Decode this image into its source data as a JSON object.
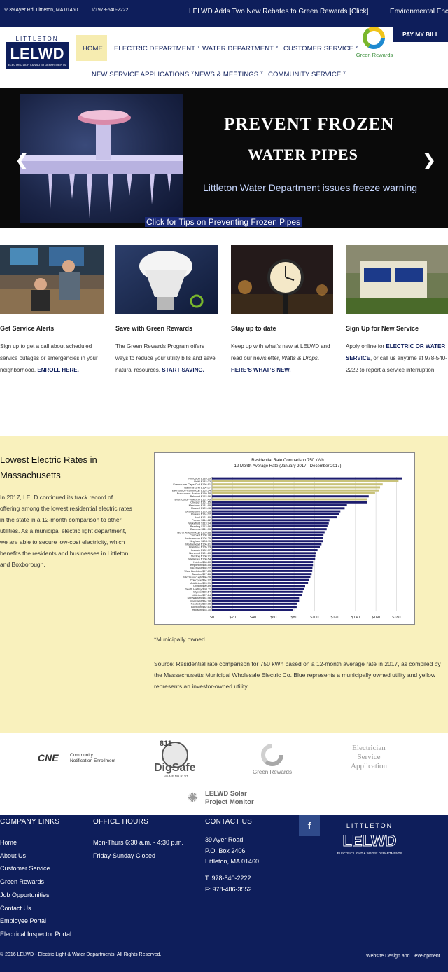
{
  "topbar": {
    "address": "39 Ayer Rd, Littleton, MA 01460",
    "phone": "978-540-2222",
    "ticker": "LELWD Adds Two New Rebates to Green Rewards [Click]",
    "ticker2": "Environmental Enc"
  },
  "header": {
    "logo_top": "LITTLETON",
    "logo_main": "LELWD",
    "logo_sub": "ELECTRIC LIGHT & WATER DEPARTMENTS",
    "pay_bill": "PAY MY BILL",
    "green_rewards": "Green Rewards",
    "nav": [
      "HOME",
      "ELECTRIC DEPARTMENT",
      "WATER DEPARTMENT",
      "CUSTOMER SERVICE",
      "NEW SERVICE APPLICATIONS",
      "NEWS & MEETINGS",
      "COMMUNITY SERVICE"
    ]
  },
  "hero": {
    "title1": "PREVENT FROZEN",
    "title2": "WATER PIPES",
    "subtitle": "Littleton Water Department issues freeze warning",
    "link": "Click for Tips on Preventing Frozen Pipes"
  },
  "cards": [
    {
      "title": "Get Service Alerts",
      "text": "Sign up to get a call about scheduled service outages or emergencies in your neighborhood. ",
      "link": "ENROLL HERE."
    },
    {
      "title": "Save with Green Rewards",
      "text": "The Green Rewards Program offers ways to reduce your utility bills and save natural resources. ",
      "link": "START SAVING."
    },
    {
      "title": "Stay up to date",
      "text_a": "Keep up with what’s new at LELWD and read our newsletter, ",
      "italic": "Watts & Drops",
      "text_b": ". ",
      "link": "HERE’S WHAT’S NEW."
    },
    {
      "title": "Sign Up for New Service",
      "text_a": "Apply online for ",
      "link": "ELECTRIC OR WATER SERVICE",
      "text_b": ", or call us anytime at 978-540-2222 to report a service interruption."
    }
  ],
  "rates": {
    "heading": "Lowest Electric Rates in Massachusetts",
    "body": "In 2017, LELD continued its track record of offering among the lowest residential electric rates in the state in a 12-month comparison to other utilities. As a municipal electric light department, we are able to secure low-cost electricity, which benefits the residents and businesses in Littleton and Boxborough.",
    "note": "*Municipally owned",
    "source": "Source: Residential rate comparison for 750 kWh based on a 12-month average rate in 2017, as compiled by the Massachusetts Municipal Wholesale Electric Co. Blue represents a municipally owned utility and yellow represents an investor-owned utility."
  },
  "chart_data": {
    "type": "bar",
    "orientation": "horizontal",
    "title": "Residential Rate Comparison 750 kWh",
    "subtitle": "12 Month Average Rate (January 2017 - December 2017)",
    "xlim": [
      0,
      190
    ],
    "xticks": [
      "$0",
      "$20",
      "$40",
      "$60",
      "$80",
      "$100",
      "$120",
      "$140",
      "$160",
      "$180"
    ],
    "grid": true,
    "colors": {
      "municipal": "#1c1c6e",
      "investor": "#c8c27a"
    },
    "bars": [
      {
        "label": "Princeton",
        "value": 185.29,
        "type": "municipal"
      },
      {
        "label": "Unitil",
        "value": 182.03,
        "type": "investor"
      },
      {
        "label": "Eversource-Cape Cod",
        "value": 166.61,
        "type": "investor"
      },
      {
        "label": "National Grid",
        "value": 164.07,
        "type": "investor"
      },
      {
        "label": "Eversource-Cambridge",
        "value": 163.34,
        "type": "investor"
      },
      {
        "label": "Eversource-Boston",
        "value": 159.18,
        "type": "investor"
      },
      {
        "label": "Belmont",
        "value": 152.96,
        "type": "municipal"
      },
      {
        "label": "Eversource-WMECO",
        "value": 151.49,
        "type": "investor"
      },
      {
        "label": "Chester",
        "value": 151.15,
        "type": "municipal"
      },
      {
        "label": "Merrimac",
        "value": 131.68,
        "type": "municipal"
      },
      {
        "label": "Russell",
        "value": 129.46,
        "type": "municipal"
      },
      {
        "label": "Georgetown",
        "value": 125.26,
        "type": "municipal"
      },
      {
        "label": "Rowley",
        "value": 124.02,
        "type": "municipal"
      },
      {
        "label": "Hull",
        "value": 121.8,
        "type": "municipal"
      },
      {
        "label": "Paxton",
        "value": 114.62,
        "type": "municipal"
      },
      {
        "label": "Wakefield",
        "value": 113.94,
        "type": "municipal"
      },
      {
        "label": "Reading",
        "value": 112.66,
        "type": "municipal"
      },
      {
        "label": "Danvers",
        "value": 111.9,
        "type": "municipal"
      },
      {
        "label": "North Attleborough",
        "value": 109.88,
        "type": "municipal"
      },
      {
        "label": "Concord",
        "value": 108.78,
        "type": "municipal"
      },
      {
        "label": "Ashburnham",
        "value": 108.25,
        "type": "municipal"
      },
      {
        "label": "Hingham",
        "value": 108.11,
        "type": "municipal"
      },
      {
        "label": "Marblehead",
        "value": 106.81,
        "type": "municipal"
      },
      {
        "label": "Braintree",
        "value": 105.23,
        "type": "municipal"
      },
      {
        "label": "Ipswich",
        "value": 102.97,
        "type": "municipal"
      },
      {
        "label": "Norwood",
        "value": 101.6,
        "type": "municipal"
      },
      {
        "label": "Sterling",
        "value": 100.91,
        "type": "municipal"
      },
      {
        "label": "Wellesley",
        "value": 100.64,
        "type": "municipal"
      },
      {
        "label": "Holden",
        "value": 98.6,
        "type": "municipal"
      },
      {
        "label": "Templeton",
        "value": 98.55,
        "type": "municipal"
      },
      {
        "label": "Westfield",
        "value": 98.02,
        "type": "municipal"
      },
      {
        "label": "West Boylston",
        "value": 97.85,
        "type": "municipal"
      },
      {
        "label": "Taunton",
        "value": 97.26,
        "type": "municipal"
      },
      {
        "label": "Middleborough",
        "value": 96.0,
        "type": "municipal"
      },
      {
        "label": "Chicopee",
        "value": 94.92,
        "type": "municipal"
      },
      {
        "label": "Middleton",
        "value": 93.71,
        "type": "municipal"
      },
      {
        "label": "Groton",
        "value": 90.89,
        "type": "municipal"
      },
      {
        "label": "South Hadley",
        "value": 90.11,
        "type": "municipal"
      },
      {
        "label": "Holyoke",
        "value": 88.64,
        "type": "municipal"
      },
      {
        "label": "Littleton",
        "value": 87.64,
        "type": "municipal"
      },
      {
        "label": "Shrewsbury",
        "value": 84.96,
        "type": "municipal"
      },
      {
        "label": "Mansfield",
        "value": 84.98,
        "type": "municipal"
      },
      {
        "label": "Peabody",
        "value": 83.06,
        "type": "municipal"
      },
      {
        "label": "Boylston",
        "value": 82.63,
        "type": "municipal"
      },
      {
        "label": "Hudson",
        "value": 78.7,
        "type": "municipal"
      }
    ]
  },
  "partners": {
    "cne_main": "CNE",
    "cne_sub1": "Community",
    "cne_sub2": "Notification Enrollment",
    "digsafe_num": "811",
    "digsafe_name": "DigSafe",
    "digsafe_states": "MA ME NH RI VT",
    "green_rewards": "Green Rewards",
    "electrician1": "Electrician",
    "electrician2": "Service",
    "electrician3": "Application",
    "solar1": "LELWD Solar",
    "solar2": "Project Monitor"
  },
  "footer": {
    "company_heading": "COMPANY LINKS",
    "company_links": [
      "Home",
      "About Us",
      "Customer Service",
      "Green Rewards",
      "Job Opportunities",
      "Contact Us",
      "Employee Portal",
      "Electrical Inspector Portal"
    ],
    "hours_heading": "OFFICE HOURS",
    "hours": [
      "Mon-Thurs 6:30 a.m. - 4:30 p.m.",
      "Friday-Sunday Closed"
    ],
    "contact_heading": "CONTACT US",
    "contact": [
      "39 Ayer Road",
      "P.O. Box 2406",
      "Littleton, MA 01460"
    ],
    "phone": "T: 978-540-2222",
    "fax": "F: 978-486-3552",
    "facebook": "f",
    "logo_top": "LITTLETON",
    "logo_main": "LELWD",
    "logo_sub": "ELECTRIC LIGHT & WATER DEPARTMENTS",
    "copyright": "© 2016 LELWD - Electric Light & Water Departments. All Rights Reserved.",
    "design": "Website Design and Development"
  }
}
